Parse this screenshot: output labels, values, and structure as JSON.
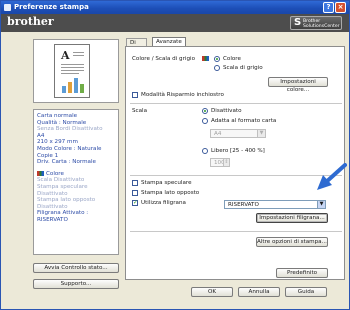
{
  "window": {
    "title": "Preferenze stampa",
    "help_label": "?",
    "close_label": "×"
  },
  "brand": {
    "logo_text": "brother",
    "solutions_s": "S",
    "solutions_line1": "Brother",
    "solutions_line2": "SolutionsCenter"
  },
  "preview": {
    "doc_letter": "A"
  },
  "settings_summary": {
    "lines_paper": [
      "Carta normale",
      "Qualità : Normale",
      "Senza Bordi Disattivato",
      "A4",
      "210 x 297 mm",
      "Modo Colore : Naturale",
      "Copie 1",
      "Driv. Carta : Normale"
    ],
    "paper_gray_index": 2,
    "color_title": "Colore",
    "lines_color": [
      "Scala Disattivato",
      "Stampa speculare Disattivato",
      "Stampa lato opposto Disattivato",
      "Filigrana Attivato : RISERVATO"
    ],
    "color_blue_index": 3
  },
  "left_buttons": {
    "status": "Avvia Controllo stato...",
    "support": "Supporto..."
  },
  "tabs": [
    {
      "label": "Di base"
    },
    {
      "label": "Avanzate"
    }
  ],
  "advanced": {
    "color_label": "Colore / Scala di grigio",
    "color_option": "Colore",
    "gray_option": "Scala di grigio",
    "color_settings_button": "Impostazioni colore...",
    "ink_save": "Modalità Risparmio inchiostro",
    "scale_label": "Scala",
    "scale_off": "Disattivato",
    "scale_fit": "Adatta al formato carta",
    "paper_select": "A4",
    "scale_free": "Libero [25 - 400 %]",
    "scale_percent": "100",
    "mirror": "Stampa speculare",
    "reverse": "Stampa lato opposto",
    "watermark": "Utilizza filigrana",
    "watermark_select": "RISERVATO",
    "watermark_settings_button": "Impostazioni filigrana...",
    "other_options_button": "Altre opzioni di stampa...",
    "default_button": "Predefinito"
  },
  "dialog": {
    "ok": "OK",
    "cancel": "Annulla",
    "help": "Guida"
  },
  "colors": {
    "titlebar": "#1d4fb8",
    "brandbar": "#4d4d4d",
    "highlight_arrow": "#2e6bd1"
  }
}
